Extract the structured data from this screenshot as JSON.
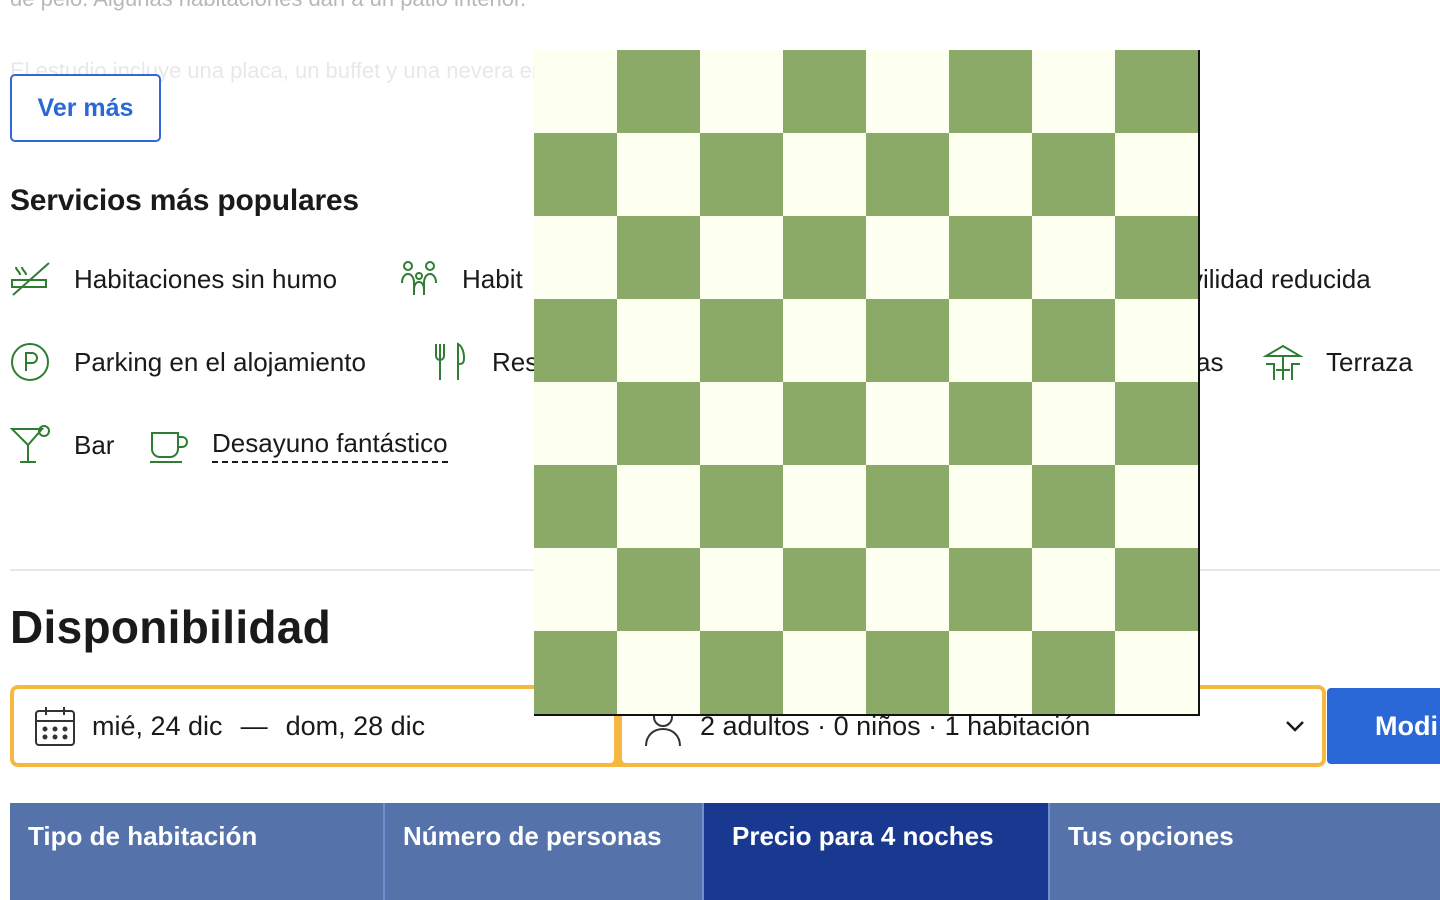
{
  "colors": {
    "accent_blue": "#2a68d8",
    "amenity_green": "#2e7d32",
    "search_border": "#f5b941",
    "table_header": "#5572aa",
    "table_header_active": "#18398f",
    "board_light": "#fdfff0",
    "board_dark": "#8baa68"
  },
  "description": {
    "line_cut": "de pelo. Algunas habitaciones dan a un patio interior.",
    "line_faded": "El estudio incluye una placa, un buffet y una nevera en la habitación y se ofrece un café en ruta de nombre"
  },
  "ver_mas_label": "Ver más",
  "popular": {
    "title": "Servicios más populares",
    "items": [
      {
        "icon": "no-smoking-icon",
        "label": "Habitaciones sin humo"
      },
      {
        "icon": "family-icon",
        "label": "Habitaciones familiares"
      },
      {
        "icon": "wheelchair-icon",
        "label": "Adaptado personas de movilidad reducida"
      },
      {
        "icon": "parking-icon",
        "label": "Parking en el alojamiento"
      },
      {
        "icon": "restaurant-icon",
        "label": "Restaurante"
      },
      {
        "icon": "rooms-icon",
        "label": "Mascotas"
      },
      {
        "icon": "terrace-icon",
        "label": "Terraza"
      },
      {
        "icon": "cocktail-icon",
        "label": "Bar"
      },
      {
        "icon": "coffee-cup-icon",
        "label": "Desayuno fantástico"
      }
    ],
    "partial_family": "Habit",
    "partial_wheelchair": "vilidad reducida",
    "partial_restaurant": "Res",
    "partial_pets": "as"
  },
  "availability": {
    "title": "Disponibilidad",
    "check_in": "mié, 24 dic",
    "dash": "—",
    "check_out": "dom, 28 dic",
    "guests": "2 adultos · 0 niños · 1 habitación",
    "modify_label": "Modi"
  },
  "table": {
    "headers": [
      "Tipo de habitación",
      "Número de personas",
      "Precio para 4 noches",
      "Tus opciones"
    ],
    "active_index": 2
  },
  "overlay": {
    "type": "checkerboard",
    "rows": 8,
    "cols": 8
  }
}
